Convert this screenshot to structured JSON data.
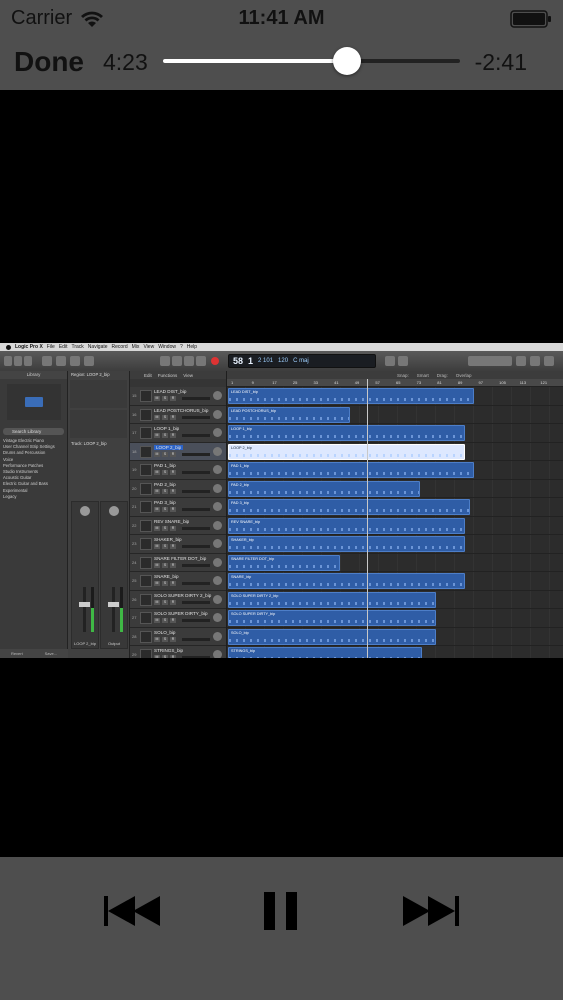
{
  "status_bar": {
    "carrier": "Carrier",
    "time": "11:41 AM",
    "wifi_icon": "wifi-icon",
    "battery_icon": "battery-icon"
  },
  "player": {
    "done_label": "Done",
    "elapsed": "4:23",
    "remaining": "-2:41",
    "progress": 0.62,
    "controls": [
      "previous-track-icon",
      "pause-icon",
      "next-track-icon"
    ]
  },
  "video": {
    "menubar": {
      "app_name": "Logic Pro X",
      "items": [
        "File",
        "Edit",
        "Track",
        "Navigate",
        "Record",
        "Mix",
        "View",
        "Window",
        "?",
        "Help"
      ]
    },
    "lcd": {
      "bar": "58",
      "beat": "1",
      "sub": "2 101",
      "tempo": "120",
      "key": "C maj"
    },
    "library": {
      "header": "Library",
      "search_placeholder": "Search Library",
      "items": [
        "Vintage Electric Piano",
        "User Channel Strip Settings",
        "Drums and Percussion",
        "Voice",
        "Performance Patches",
        "Studio Instruments",
        "Acoustic Guitar",
        "Electric Guitar and Bass",
        "Experimental",
        "Legacy"
      ],
      "footer": [
        "Revert",
        "Save..."
      ]
    },
    "inspector": {
      "region_label": "Region: LOOP 2_bip",
      "track_label": "Track: LOOP 2_bip",
      "strip_names": [
        "LOOP 2_bip",
        "Output"
      ]
    },
    "tracks_menu": [
      "Edit",
      "Functions",
      "View"
    ],
    "arrange_menu": [
      "Snap:",
      "Smart",
      "Drag:",
      "Overlap"
    ],
    "ruler": [
      "1",
      "9",
      "17",
      "25",
      "33",
      "41",
      "49",
      "57",
      "65",
      "73",
      "81",
      "89",
      "97",
      "105",
      "113",
      "121"
    ],
    "tracks": [
      {
        "num": "15",
        "name": "LEAD DIST_bip",
        "region": "LEAD DIST_bip",
        "selected": false
      },
      {
        "num": "16",
        "name": "LEAD POSTCHORUS_bip",
        "region": "LEAD POSTCHORUS_bip",
        "selected": false
      },
      {
        "num": "17",
        "name": "LOOP 1_bip",
        "region": "LOOP 1_bip",
        "selected": false
      },
      {
        "num": "18",
        "name": "LOOP 2_bip",
        "region": "LOOP 2_bip",
        "selected": true
      },
      {
        "num": "19",
        "name": "PAD 1_bip",
        "region": "PAD 1_bip",
        "selected": false
      },
      {
        "num": "20",
        "name": "PAD 2_bip",
        "region": "PAD 2_bip",
        "selected": false
      },
      {
        "num": "21",
        "name": "PAD 3_bip",
        "region": "PAD 3_bip",
        "selected": false
      },
      {
        "num": "22",
        "name": "REV SNARE_bip",
        "region": "REV SNARE_bip",
        "selected": false
      },
      {
        "num": "23",
        "name": "SHAKER_bip",
        "region": "SHAKER_bip",
        "selected": false
      },
      {
        "num": "24",
        "name": "SNARE FILTER DOT_bip",
        "region": "SNARE FILTER DOT_bip",
        "selected": false
      },
      {
        "num": "25",
        "name": "SNARE_bip",
        "region": "SNARE_bip",
        "selected": false
      },
      {
        "num": "26",
        "name": "SOLO SUPER DIRTY 2_bip",
        "region": "SOLO SUPER DIRTY 2_bip",
        "selected": false
      },
      {
        "num": "27",
        "name": "SOLO SUPER DIRTY_bip",
        "region": "SOLO SUPER DIRTY_bip",
        "selected": false
      },
      {
        "num": "28",
        "name": "SOLO_bip",
        "region": "SOLO_bip",
        "selected": false
      },
      {
        "num": "29",
        "name": "STRINGS_bip",
        "region": "STRINGS_bip",
        "selected": false
      }
    ]
  }
}
